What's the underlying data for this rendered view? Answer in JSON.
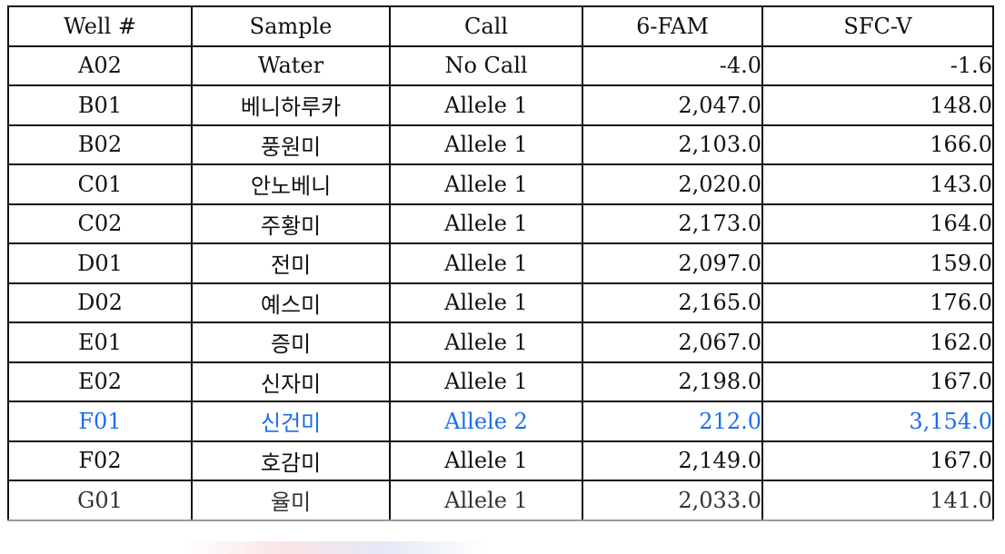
{
  "table": {
    "headers": [
      "Well #",
      "Sample",
      "Call",
      "6-FAM",
      "SFC-V"
    ],
    "highlight_color": "#1a6df0",
    "rows": [
      {
        "well": "A02",
        "sample": "Water",
        "call": "No Call",
        "fam": "-4.0",
        "sfcv": "-1.6"
      },
      {
        "well": "B01",
        "sample": "베니하루카",
        "call": "Allele 1",
        "fam": "2,047.0",
        "sfcv": "148.0"
      },
      {
        "well": "B02",
        "sample": "풍원미",
        "call": "Allele 1",
        "fam": "2,103.0",
        "sfcv": "166.0"
      },
      {
        "well": "C01",
        "sample": "안노베니",
        "call": "Allele 1",
        "fam": "2,020.0",
        "sfcv": "143.0"
      },
      {
        "well": "C02",
        "sample": "주황미",
        "call": "Allele 1",
        "fam": "2,173.0",
        "sfcv": "164.0"
      },
      {
        "well": "D01",
        "sample": "전미",
        "call": "Allele 1",
        "fam": "2,097.0",
        "sfcv": "159.0"
      },
      {
        "well": "D02",
        "sample": "예스미",
        "call": "Allele 1",
        "fam": "2,165.0",
        "sfcv": "176.0"
      },
      {
        "well": "E01",
        "sample": "증미",
        "call": "Allele 1",
        "fam": "2,067.0",
        "sfcv": "162.0"
      },
      {
        "well": "E02",
        "sample": "신자미",
        "call": "Allele 1",
        "fam": "2,198.0",
        "sfcv": "167.0"
      },
      {
        "well": "F01",
        "sample": "신건미",
        "call": "Allele 2",
        "fam": "212.0",
        "sfcv": "3,154.0"
      },
      {
        "well": "F02",
        "sample": "호감미",
        "call": "Allele 1",
        "fam": "2,149.0",
        "sfcv": "167.0"
      },
      {
        "well": "G01",
        "sample": "율미",
        "call": "Allele 1",
        "fam": "2,033.0",
        "sfcv": "141.0"
      }
    ]
  }
}
